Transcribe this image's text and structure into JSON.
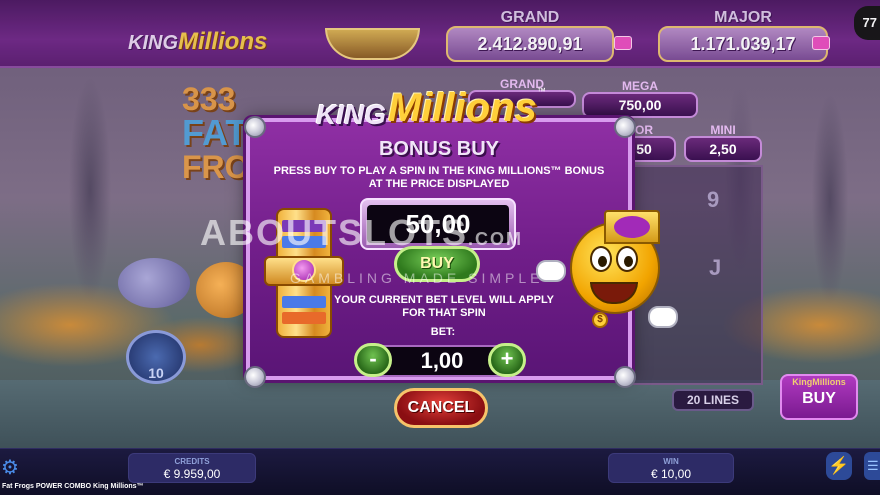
{
  "header": {
    "logo_king": "KING",
    "logo_millions": "Millions",
    "jackpots": [
      {
        "title": "GRAND",
        "value": "2.412.890,91"
      },
      {
        "title": "MAJOR",
        "value": "1.171.039,17"
      }
    ],
    "corner_badge": "77"
  },
  "mini_jackpots": {
    "grand": {
      "title": "GRAND"
    },
    "mega": {
      "title": "MEGA",
      "value": "750,00"
    },
    "minor": {
      "title": "OR",
      "value": "50"
    },
    "mini": {
      "title": "MINI",
      "value": "2,50"
    }
  },
  "background": {
    "game_title_num": "333",
    "game_title_word": "FAT",
    "game_title_sub": "FROG",
    "coin_count": "10",
    "reel_symbols": [
      "9",
      "J"
    ],
    "lines_label": "20 LINES",
    "side_buy": {
      "logo": "KingMillions",
      "label": "BUY"
    }
  },
  "watermark": {
    "main": "ABOUTSLOTS",
    "domain": ".COM",
    "tagline": "GAMBLING MADE SIMPLE"
  },
  "dialog": {
    "logo_king": "KING",
    "logo_millions": "Millions",
    "logo_tm": "™",
    "title": "BONUS BUY",
    "description": "PRESS BUY TO PLAY A SPIN IN THE KING MILLIONS™ BONUS AT THE PRICE DISPLAYED",
    "price": "50,00",
    "buy_label": "BUY",
    "bet_note": "YOUR CURRENT BET LEVEL WILL APPLY FOR THAT SPIN",
    "bet_label": "BET:",
    "bet_value": "1,00",
    "minus_label": "-",
    "plus_label": "+",
    "cancel_label": "CANCEL",
    "mascot_coin": "$"
  },
  "bottom_bar": {
    "credits_label": "CREDITS",
    "credits_value": "€ 9.959,00",
    "win_label": "WIN",
    "win_value": "€ 10,00",
    "settings_icon": "⚙",
    "turbo_icon": "⚡",
    "menu_icon": "☰",
    "game_name": "Fat Frogs POWER COMBO King Millions™"
  },
  "colors": {
    "dialog_bg": "#7a1f92",
    "buy_green": "#3f9a28",
    "cancel_red": "#b5151a",
    "gold": "#ffcf3a"
  }
}
